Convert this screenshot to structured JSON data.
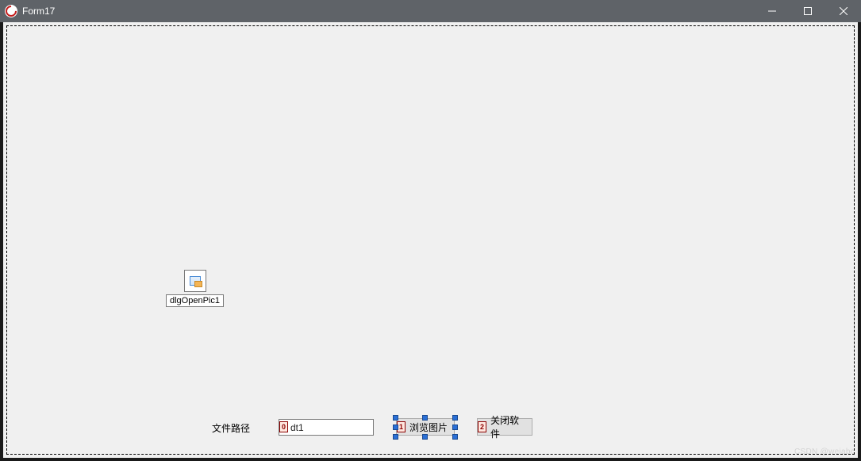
{
  "window": {
    "title": "Form17"
  },
  "designer": {
    "component": {
      "name": "dlgOpenPic1"
    },
    "labels": {
      "filepath": "文件路径"
    },
    "edit": {
      "text": "dt1"
    },
    "buttons": {
      "browse": "浏览图片",
      "close": "关闭软件"
    },
    "tab_order": {
      "edit": "0",
      "browse": "1",
      "close": "2"
    }
  },
  "watermark": "CSDN @weiabc"
}
